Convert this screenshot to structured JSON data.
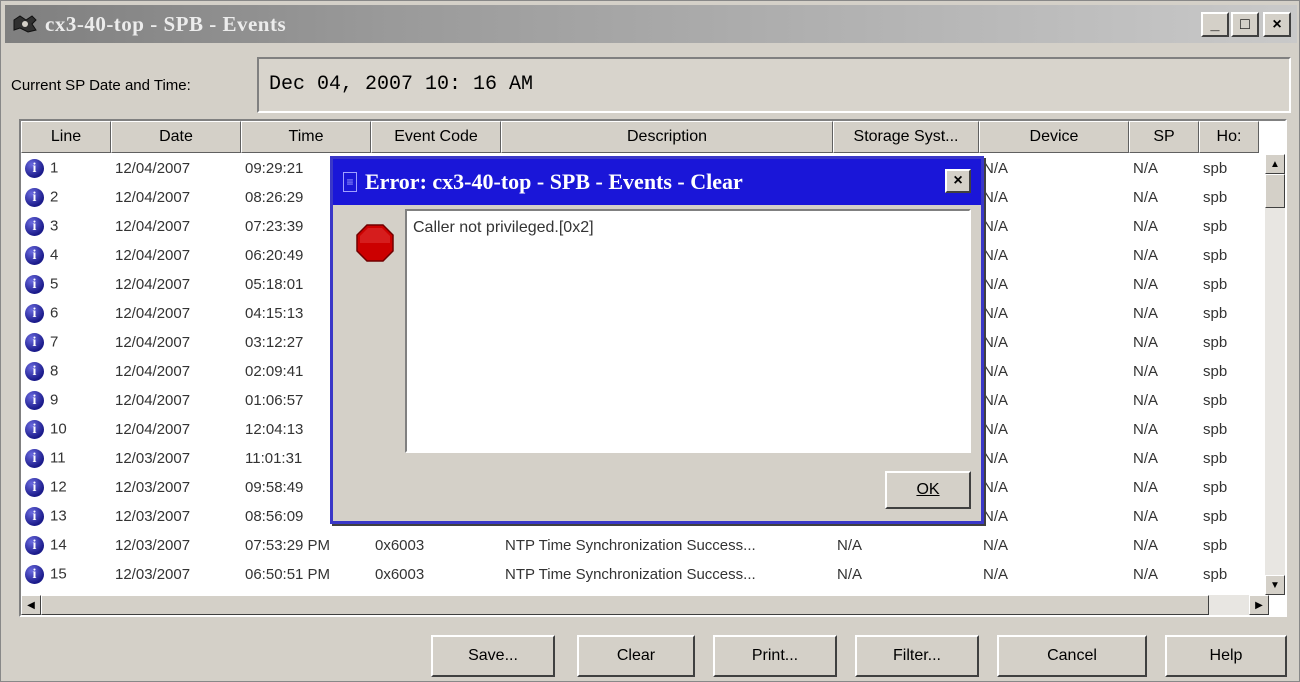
{
  "window": {
    "title": "cx3-40-top  - SPB - Events",
    "minimize_label": "_",
    "maximize_label": "□",
    "close_label": "×"
  },
  "sp_time": {
    "label": "Current SP Date and Time:",
    "value": "Dec 04, 2007 10: 16 AM"
  },
  "table": {
    "columns": [
      "Line",
      "Date",
      "Time",
      "Event Code",
      "Description",
      "Storage Syst...",
      "Device",
      "SP",
      "Ho:"
    ],
    "rows": [
      {
        "line": "1",
        "date": "12/04/2007",
        "time": "09:29:21",
        "code": "",
        "desc": "",
        "storage": "",
        "device": "N/A",
        "sp": "N/A",
        "host": "spb"
      },
      {
        "line": "2",
        "date": "12/04/2007",
        "time": "08:26:29",
        "code": "",
        "desc": "",
        "storage": "",
        "device": "N/A",
        "sp": "N/A",
        "host": "spb"
      },
      {
        "line": "3",
        "date": "12/04/2007",
        "time": "07:23:39",
        "code": "",
        "desc": "",
        "storage": "",
        "device": "N/A",
        "sp": "N/A",
        "host": "spb"
      },
      {
        "line": "4",
        "date": "12/04/2007",
        "time": "06:20:49",
        "code": "",
        "desc": "",
        "storage": "",
        "device": "N/A",
        "sp": "N/A",
        "host": "spb"
      },
      {
        "line": "5",
        "date": "12/04/2007",
        "time": "05:18:01",
        "code": "",
        "desc": "",
        "storage": "",
        "device": "N/A",
        "sp": "N/A",
        "host": "spb"
      },
      {
        "line": "6",
        "date": "12/04/2007",
        "time": "04:15:13",
        "code": "",
        "desc": "",
        "storage": "",
        "device": "N/A",
        "sp": "N/A",
        "host": "spb"
      },
      {
        "line": "7",
        "date": "12/04/2007",
        "time": "03:12:27",
        "code": "",
        "desc": "",
        "storage": "",
        "device": "N/A",
        "sp": "N/A",
        "host": "spb"
      },
      {
        "line": "8",
        "date": "12/04/2007",
        "time": "02:09:41",
        "code": "",
        "desc": "",
        "storage": "",
        "device": "N/A",
        "sp": "N/A",
        "host": "spb"
      },
      {
        "line": "9",
        "date": "12/04/2007",
        "time": "01:06:57",
        "code": "",
        "desc": "",
        "storage": "",
        "device": "N/A",
        "sp": "N/A",
        "host": "spb"
      },
      {
        "line": "10",
        "date": "12/04/2007",
        "time": "12:04:13",
        "code": "",
        "desc": "",
        "storage": "",
        "device": "N/A",
        "sp": "N/A",
        "host": "spb"
      },
      {
        "line": "11",
        "date": "12/03/2007",
        "time": "11:01:31",
        "code": "",
        "desc": "",
        "storage": "",
        "device": "N/A",
        "sp": "N/A",
        "host": "spb"
      },
      {
        "line": "12",
        "date": "12/03/2007",
        "time": "09:58:49",
        "code": "",
        "desc": "",
        "storage": "",
        "device": "N/A",
        "sp": "N/A",
        "host": "spb"
      },
      {
        "line": "13",
        "date": "12/03/2007",
        "time": "08:56:09",
        "code": "",
        "desc": "",
        "storage": "",
        "device": "N/A",
        "sp": "N/A",
        "host": "spb"
      },
      {
        "line": "14",
        "date": "12/03/2007",
        "time": "07:53:29 PM",
        "code": "0x6003",
        "desc": "NTP Time Synchronization Success...",
        "storage": "N/A",
        "device": "N/A",
        "sp": "N/A",
        "host": "spb"
      },
      {
        "line": "15",
        "date": "12/03/2007",
        "time": "06:50:51 PM",
        "code": "0x6003",
        "desc": "NTP Time Synchronization Success...",
        "storage": "N/A",
        "device": "N/A",
        "sp": "N/A",
        "host": "spb"
      }
    ]
  },
  "buttons": {
    "save": "Save...",
    "clear": "Clear",
    "print": "Print...",
    "filter": "Filter...",
    "cancel": "Cancel",
    "help": "Help"
  },
  "dialog": {
    "title": "Error: cx3-40-top  - SPB - Events - Clear",
    "message": "Caller not privileged.[0x2]",
    "ok_label": "OK",
    "close_label": "×",
    "icon": "stop-icon"
  },
  "colors": {
    "dialog_title_bg": "#1a16d8",
    "window_title_bg": "#8c8c8c",
    "stop_red": "#cc0000",
    "info_blue": "#1a1a8a"
  }
}
